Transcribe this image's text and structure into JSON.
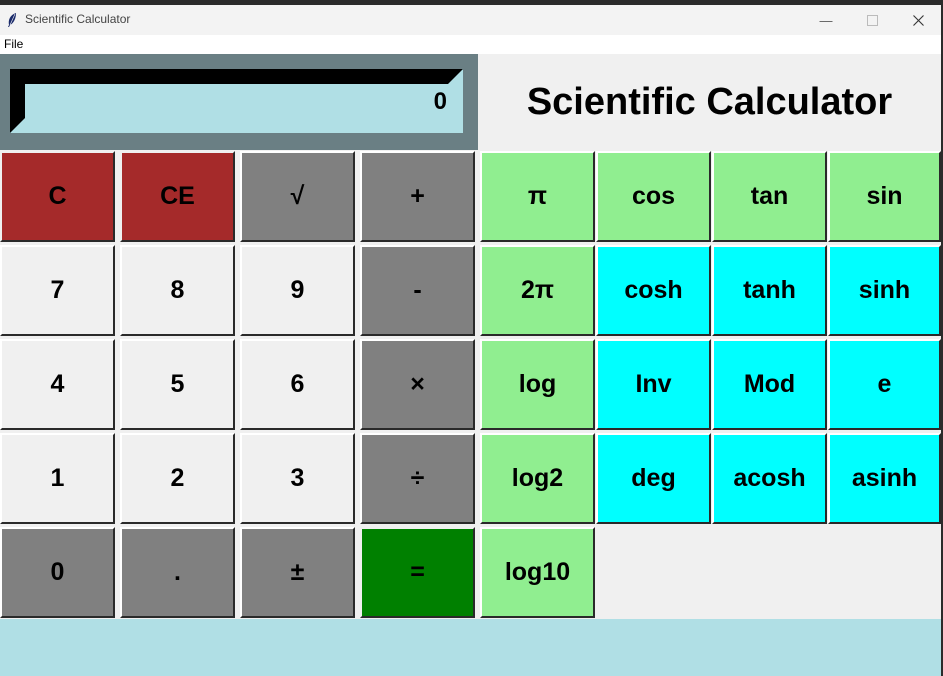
{
  "window": {
    "title": "Scientific Calculator"
  },
  "menu": {
    "file": "File"
  },
  "display": {
    "value": "0"
  },
  "heading": "Scientific Calculator",
  "colors": {
    "clear": "#a52a2a",
    "operator": "#808080",
    "digit": "#f0f0f0",
    "equals": "#008000",
    "scientific": "#90ee90",
    "advanced": "#00ffff",
    "display_bg": "#b0dfe5"
  },
  "buttons": [
    [
      {
        "label": "C",
        "name": "clear-button",
        "color": "clear"
      },
      {
        "label": "CE",
        "name": "clear-entry-button",
        "color": "clear"
      },
      {
        "label": "√",
        "name": "sqrt-button",
        "color": "operator"
      },
      {
        "label": "+",
        "name": "add-button",
        "color": "operator"
      },
      {
        "label": "π",
        "name": "pi-button",
        "color": "scientific"
      },
      {
        "label": "cos",
        "name": "cos-button",
        "color": "scientific"
      },
      {
        "label": "tan",
        "name": "tan-button",
        "color": "scientific"
      },
      {
        "label": "sin",
        "name": "sin-button",
        "color": "scientific"
      }
    ],
    [
      {
        "label": "7",
        "name": "digit-7-button",
        "color": "digit"
      },
      {
        "label": "8",
        "name": "digit-8-button",
        "color": "digit"
      },
      {
        "label": "9",
        "name": "digit-9-button",
        "color": "digit"
      },
      {
        "label": "-",
        "name": "subtract-button",
        "color": "operator"
      },
      {
        "label": "2π",
        "name": "two-pi-button",
        "color": "scientific"
      },
      {
        "label": "cosh",
        "name": "cosh-button",
        "color": "advanced"
      },
      {
        "label": "tanh",
        "name": "tanh-button",
        "color": "advanced"
      },
      {
        "label": "sinh",
        "name": "sinh-button",
        "color": "advanced"
      }
    ],
    [
      {
        "label": "4",
        "name": "digit-4-button",
        "color": "digit"
      },
      {
        "label": "5",
        "name": "digit-5-button",
        "color": "digit"
      },
      {
        "label": "6",
        "name": "digit-6-button",
        "color": "digit"
      },
      {
        "label": "×",
        "name": "multiply-button",
        "color": "operator"
      },
      {
        "label": "log",
        "name": "log-button",
        "color": "scientific"
      },
      {
        "label": "Inv",
        "name": "inverse-button",
        "color": "advanced"
      },
      {
        "label": "Mod",
        "name": "mod-button",
        "color": "advanced"
      },
      {
        "label": "e",
        "name": "e-button",
        "color": "advanced"
      }
    ],
    [
      {
        "label": "1",
        "name": "digit-1-button",
        "color": "digit"
      },
      {
        "label": "2",
        "name": "digit-2-button",
        "color": "digit"
      },
      {
        "label": "3",
        "name": "digit-3-button",
        "color": "digit"
      },
      {
        "label": "÷",
        "name": "divide-button",
        "color": "operator"
      },
      {
        "label": "log2",
        "name": "log2-button",
        "color": "scientific"
      },
      {
        "label": "deg",
        "name": "deg-button",
        "color": "advanced"
      },
      {
        "label": "acosh",
        "name": "acosh-button",
        "color": "advanced"
      },
      {
        "label": "asinh",
        "name": "asinh-button",
        "color": "advanced"
      }
    ],
    [
      {
        "label": "0",
        "name": "digit-0-button",
        "color": "operator"
      },
      {
        "label": ".",
        "name": "decimal-button",
        "color": "operator"
      },
      {
        "label": "±",
        "name": "sign-toggle-button",
        "color": "operator"
      },
      {
        "label": "=",
        "name": "equals-button",
        "color": "equals"
      },
      {
        "label": "log10",
        "name": "log10-button",
        "color": "scientific"
      }
    ]
  ]
}
